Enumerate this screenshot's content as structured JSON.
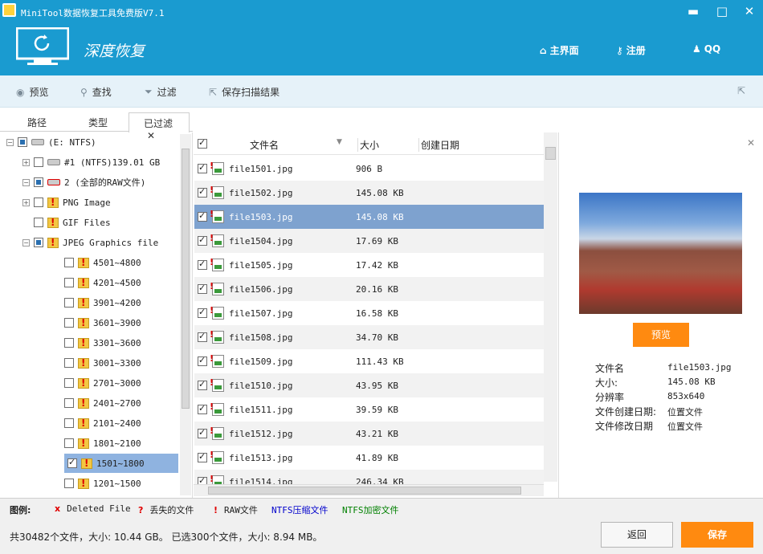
{
  "window": {
    "title": "MiniTool数据恢复工具免费版V7.1",
    "min_label": "▬",
    "max_label": "□",
    "close_label": "✕"
  },
  "header": {
    "title": "深度恢复",
    "nav": [
      {
        "label": "主界面",
        "icon": "home-icon"
      },
      {
        "label": "注册",
        "icon": "key-icon"
      },
      {
        "label": "QQ",
        "icon": "qq-icon"
      }
    ]
  },
  "toolbar": {
    "preview_label": "预览",
    "find_label": "查找",
    "filter_label": "过滤",
    "save_scan_label": "保存扫描结果"
  },
  "tabs": [
    {
      "label": "路径"
    },
    {
      "label": "类型"
    },
    {
      "label": "已过滤",
      "close": "✕"
    }
  ],
  "tree": [
    {
      "label": "(E: NTFS)",
      "level": 0,
      "expander": "−",
      "check": "partial",
      "icon": "drive"
    },
    {
      "label": "#1  (NTFS)139.01 GB",
      "level": 1,
      "expander": "+",
      "check": "none",
      "icon": "drive"
    },
    {
      "label": "2  (全部的RAW文件)",
      "level": 1,
      "expander": "−",
      "check": "partial",
      "icon": "drive-raw"
    },
    {
      "label": "PNG Image",
      "level": 2,
      "expander": "+",
      "check": "none",
      "icon": "folder"
    },
    {
      "label": "GIF Files",
      "level": 2,
      "expander": "",
      "check": "none",
      "icon": "folder"
    },
    {
      "label": "JPEG Graphics file",
      "level": 2,
      "expander": "−",
      "check": "partial",
      "icon": "folder"
    },
    {
      "label": "4501~4800",
      "level": 3,
      "expander": "",
      "check": "none",
      "icon": "folder"
    },
    {
      "label": "4201~4500",
      "level": 3,
      "expander": "",
      "check": "none",
      "icon": "folder"
    },
    {
      "label": "3901~4200",
      "level": 3,
      "expander": "",
      "check": "none",
      "icon": "folder"
    },
    {
      "label": "3601~3900",
      "level": 3,
      "expander": "",
      "check": "none",
      "icon": "folder"
    },
    {
      "label": "3301~3600",
      "level": 3,
      "expander": "",
      "check": "none",
      "icon": "folder"
    },
    {
      "label": "3001~3300",
      "level": 3,
      "expander": "",
      "check": "none",
      "icon": "folder"
    },
    {
      "label": "2701~3000",
      "level": 3,
      "expander": "",
      "check": "none",
      "icon": "folder"
    },
    {
      "label": "2401~2700",
      "level": 3,
      "expander": "",
      "check": "none",
      "icon": "folder"
    },
    {
      "label": "2101~2400",
      "level": 3,
      "expander": "",
      "check": "none",
      "icon": "folder"
    },
    {
      "label": "1801~2100",
      "level": 3,
      "expander": "",
      "check": "none",
      "icon": "folder"
    },
    {
      "label": "1501~1800",
      "level": 3,
      "expander": "",
      "check": "checked",
      "icon": "folder",
      "selected": true
    },
    {
      "label": "1201~1500",
      "level": 3,
      "expander": "",
      "check": "none",
      "icon": "folder"
    }
  ],
  "filelist": {
    "headers": {
      "name": "文件名",
      "size": "大小",
      "created": "创建日期"
    },
    "rows": [
      {
        "name": "file1501.jpg",
        "size": "906 B"
      },
      {
        "name": "file1502.jpg",
        "size": "145.08 KB"
      },
      {
        "name": "file1503.jpg",
        "size": "145.08 KB",
        "selected": true
      },
      {
        "name": "file1504.jpg",
        "size": "17.69 KB"
      },
      {
        "name": "file1505.jpg",
        "size": "17.42 KB"
      },
      {
        "name": "file1506.jpg",
        "size": "20.16 KB"
      },
      {
        "name": "file1507.jpg",
        "size": "16.58 KB"
      },
      {
        "name": "file1508.jpg",
        "size": "34.70 KB"
      },
      {
        "name": "file1509.jpg",
        "size": "111.43 KB"
      },
      {
        "name": "file1510.jpg",
        "size": "43.95 KB"
      },
      {
        "name": "file1511.jpg",
        "size": "39.59 KB"
      },
      {
        "name": "file1512.jpg",
        "size": "43.21 KB"
      },
      {
        "name": "file1513.jpg",
        "size": "41.89 KB"
      },
      {
        "name": "file1514.jpg",
        "size": "246.34 KB"
      }
    ]
  },
  "preview": {
    "button_label": "预览",
    "props": [
      {
        "label": "文件名",
        "value": "file1503.jpg"
      },
      {
        "label": "大小:",
        "value": "145.08 KB"
      },
      {
        "label": "分辨率",
        "value": "853x640"
      },
      {
        "label": "文件创建日期:",
        "value": "位置文件"
      },
      {
        "label": "文件修改日期",
        "value": "位置文件"
      }
    ]
  },
  "legend": {
    "title": "图例:",
    "items": [
      {
        "mark": "x",
        "label": "Deleted File",
        "color": "#e00000"
      },
      {
        "mark": "?",
        "label": "丢失的文件",
        "color": "#e00000"
      },
      {
        "mark": "!",
        "label": "RAW文件",
        "color": "#e00000"
      },
      {
        "mark": "",
        "label": "NTFS压缩文件",
        "color": "#0000cc"
      },
      {
        "mark": "",
        "label": "NTFS加密文件",
        "color": "#008000"
      }
    ]
  },
  "status": {
    "text": "共30482个文件，大小: 10.44 GB。 已选300个文件，大小: 8.94 MB。",
    "back_label": "返回",
    "save_label": "保存"
  },
  "colors": {
    "accent": "#1a9bd0",
    "orange": "#ff8a10",
    "selection": "#7ea2cf"
  }
}
